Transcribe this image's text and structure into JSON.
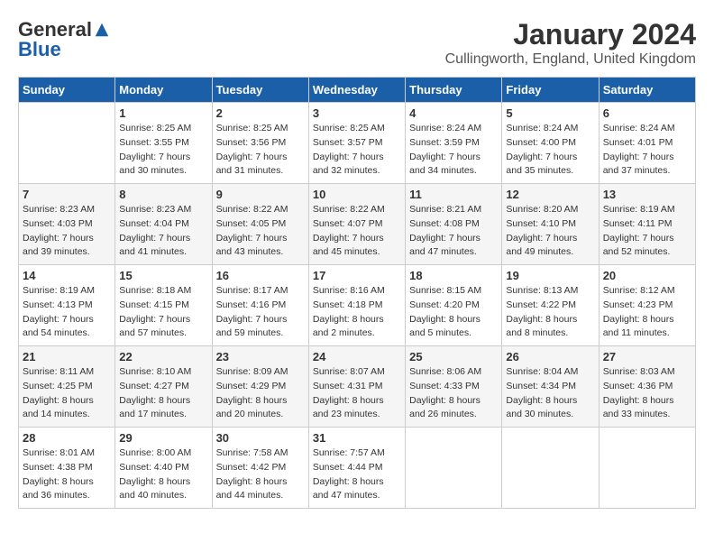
{
  "logo": {
    "general": "General",
    "blue": "Blue"
  },
  "title": "January 2024",
  "location": "Cullingworth, England, United Kingdom",
  "days_of_week": [
    "Sunday",
    "Monday",
    "Tuesday",
    "Wednesday",
    "Thursday",
    "Friday",
    "Saturday"
  ],
  "weeks": [
    [
      {
        "day": "",
        "sunrise": "",
        "sunset": "",
        "daylight": ""
      },
      {
        "day": "1",
        "sunrise": "Sunrise: 8:25 AM",
        "sunset": "Sunset: 3:55 PM",
        "daylight": "Daylight: 7 hours and 30 minutes."
      },
      {
        "day": "2",
        "sunrise": "Sunrise: 8:25 AM",
        "sunset": "Sunset: 3:56 PM",
        "daylight": "Daylight: 7 hours and 31 minutes."
      },
      {
        "day": "3",
        "sunrise": "Sunrise: 8:25 AM",
        "sunset": "Sunset: 3:57 PM",
        "daylight": "Daylight: 7 hours and 32 minutes."
      },
      {
        "day": "4",
        "sunrise": "Sunrise: 8:24 AM",
        "sunset": "Sunset: 3:59 PM",
        "daylight": "Daylight: 7 hours and 34 minutes."
      },
      {
        "day": "5",
        "sunrise": "Sunrise: 8:24 AM",
        "sunset": "Sunset: 4:00 PM",
        "daylight": "Daylight: 7 hours and 35 minutes."
      },
      {
        "day": "6",
        "sunrise": "Sunrise: 8:24 AM",
        "sunset": "Sunset: 4:01 PM",
        "daylight": "Daylight: 7 hours and 37 minutes."
      }
    ],
    [
      {
        "day": "7",
        "sunrise": "Sunrise: 8:23 AM",
        "sunset": "Sunset: 4:03 PM",
        "daylight": "Daylight: 7 hours and 39 minutes."
      },
      {
        "day": "8",
        "sunrise": "Sunrise: 8:23 AM",
        "sunset": "Sunset: 4:04 PM",
        "daylight": "Daylight: 7 hours and 41 minutes."
      },
      {
        "day": "9",
        "sunrise": "Sunrise: 8:22 AM",
        "sunset": "Sunset: 4:05 PM",
        "daylight": "Daylight: 7 hours and 43 minutes."
      },
      {
        "day": "10",
        "sunrise": "Sunrise: 8:22 AM",
        "sunset": "Sunset: 4:07 PM",
        "daylight": "Daylight: 7 hours and 45 minutes."
      },
      {
        "day": "11",
        "sunrise": "Sunrise: 8:21 AM",
        "sunset": "Sunset: 4:08 PM",
        "daylight": "Daylight: 7 hours and 47 minutes."
      },
      {
        "day": "12",
        "sunrise": "Sunrise: 8:20 AM",
        "sunset": "Sunset: 4:10 PM",
        "daylight": "Daylight: 7 hours and 49 minutes."
      },
      {
        "day": "13",
        "sunrise": "Sunrise: 8:19 AM",
        "sunset": "Sunset: 4:11 PM",
        "daylight": "Daylight: 7 hours and 52 minutes."
      }
    ],
    [
      {
        "day": "14",
        "sunrise": "Sunrise: 8:19 AM",
        "sunset": "Sunset: 4:13 PM",
        "daylight": "Daylight: 7 hours and 54 minutes."
      },
      {
        "day": "15",
        "sunrise": "Sunrise: 8:18 AM",
        "sunset": "Sunset: 4:15 PM",
        "daylight": "Daylight: 7 hours and 57 minutes."
      },
      {
        "day": "16",
        "sunrise": "Sunrise: 8:17 AM",
        "sunset": "Sunset: 4:16 PM",
        "daylight": "Daylight: 7 hours and 59 minutes."
      },
      {
        "day": "17",
        "sunrise": "Sunrise: 8:16 AM",
        "sunset": "Sunset: 4:18 PM",
        "daylight": "Daylight: 8 hours and 2 minutes."
      },
      {
        "day": "18",
        "sunrise": "Sunrise: 8:15 AM",
        "sunset": "Sunset: 4:20 PM",
        "daylight": "Daylight: 8 hours and 5 minutes."
      },
      {
        "day": "19",
        "sunrise": "Sunrise: 8:13 AM",
        "sunset": "Sunset: 4:22 PM",
        "daylight": "Daylight: 8 hours and 8 minutes."
      },
      {
        "day": "20",
        "sunrise": "Sunrise: 8:12 AM",
        "sunset": "Sunset: 4:23 PM",
        "daylight": "Daylight: 8 hours and 11 minutes."
      }
    ],
    [
      {
        "day": "21",
        "sunrise": "Sunrise: 8:11 AM",
        "sunset": "Sunset: 4:25 PM",
        "daylight": "Daylight: 8 hours and 14 minutes."
      },
      {
        "day": "22",
        "sunrise": "Sunrise: 8:10 AM",
        "sunset": "Sunset: 4:27 PM",
        "daylight": "Daylight: 8 hours and 17 minutes."
      },
      {
        "day": "23",
        "sunrise": "Sunrise: 8:09 AM",
        "sunset": "Sunset: 4:29 PM",
        "daylight": "Daylight: 8 hours and 20 minutes."
      },
      {
        "day": "24",
        "sunrise": "Sunrise: 8:07 AM",
        "sunset": "Sunset: 4:31 PM",
        "daylight": "Daylight: 8 hours and 23 minutes."
      },
      {
        "day": "25",
        "sunrise": "Sunrise: 8:06 AM",
        "sunset": "Sunset: 4:33 PM",
        "daylight": "Daylight: 8 hours and 26 minutes."
      },
      {
        "day": "26",
        "sunrise": "Sunrise: 8:04 AM",
        "sunset": "Sunset: 4:34 PM",
        "daylight": "Daylight: 8 hours and 30 minutes."
      },
      {
        "day": "27",
        "sunrise": "Sunrise: 8:03 AM",
        "sunset": "Sunset: 4:36 PM",
        "daylight": "Daylight: 8 hours and 33 minutes."
      }
    ],
    [
      {
        "day": "28",
        "sunrise": "Sunrise: 8:01 AM",
        "sunset": "Sunset: 4:38 PM",
        "daylight": "Daylight: 8 hours and 36 minutes."
      },
      {
        "day": "29",
        "sunrise": "Sunrise: 8:00 AM",
        "sunset": "Sunset: 4:40 PM",
        "daylight": "Daylight: 8 hours and 40 minutes."
      },
      {
        "day": "30",
        "sunrise": "Sunrise: 7:58 AM",
        "sunset": "Sunset: 4:42 PM",
        "daylight": "Daylight: 8 hours and 44 minutes."
      },
      {
        "day": "31",
        "sunrise": "Sunrise: 7:57 AM",
        "sunset": "Sunset: 4:44 PM",
        "daylight": "Daylight: 8 hours and 47 minutes."
      },
      {
        "day": "",
        "sunrise": "",
        "sunset": "",
        "daylight": ""
      },
      {
        "day": "",
        "sunrise": "",
        "sunset": "",
        "daylight": ""
      },
      {
        "day": "",
        "sunrise": "",
        "sunset": "",
        "daylight": ""
      }
    ]
  ],
  "colors": {
    "header_bg": "#1a5fa8",
    "header_text": "#ffffff",
    "border": "#cccccc",
    "row_shaded": "#f5f5f5",
    "row_white": "#ffffff"
  }
}
